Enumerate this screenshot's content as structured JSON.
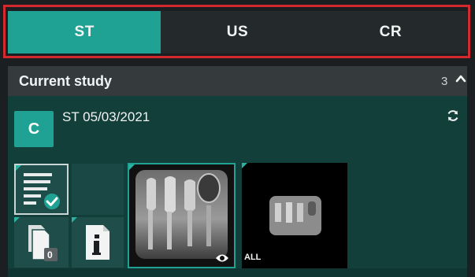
{
  "tabs": [
    {
      "label": "ST",
      "active": true
    },
    {
      "label": "US",
      "active": false
    },
    {
      "label": "CR",
      "active": false
    }
  ],
  "section": {
    "title": "Current study",
    "count": "3"
  },
  "study": {
    "avatar_letter": "C",
    "name": "ST 05/03/2021"
  },
  "thumbnails": {
    "documents_count": "0",
    "all_label": "ALL"
  },
  "colors": {
    "accent": "#1fa293",
    "panel": "#133f3b",
    "highlight_border": "#d42a2f"
  },
  "icons": [
    "report-check-icon",
    "documents-icon",
    "info-icon",
    "refresh-icon",
    "eye-icon",
    "chevron-up-icon"
  ]
}
